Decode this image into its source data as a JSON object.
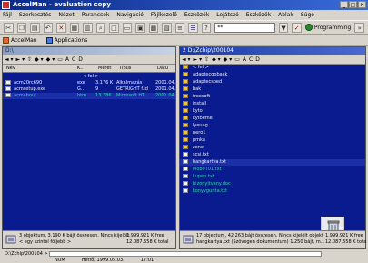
{
  "window": {
    "title": "AccelMan - evaluation copy"
  },
  "menu": [
    "Fájl",
    "Szerkesztés",
    "Nézet",
    "Parancsok",
    "Navigáció",
    "Fájlkezelő",
    "Eszközök",
    "Lejátszó",
    "Eszközök",
    "Ablak",
    "Súgó"
  ],
  "toolbar": {
    "combo_value": "**",
    "program_label": "Programming"
  },
  "toolbar2": {
    "accelman_label": "AccelMan",
    "applications_label": "Applications"
  },
  "left_panel": {
    "path": "D:\\",
    "columns": {
      "name": "Név",
      "ext": "K..",
      "size": "Méret",
      "type": "Típus",
      "date": "Dátu"
    },
    "files": [
      {
        "name": "acm20rc690",
        "ext": "exe",
        "size": "3.176 K",
        "type": "Alkalmazás",
        "date": "2001.04."
      },
      {
        "name": "acmsetup.exe",
        "ext": "G..",
        "size": "9",
        "type": "GETRIGHT f.id",
        "date": "2001.04."
      },
      {
        "name": "acmabout",
        "ext": "htm",
        "size": "13.786",
        "type": "Microsoft HT...",
        "date": "2001.04."
      }
    ],
    "status_line1": "3 objektum, 3.190 K bájt összesen. Nincs kijelölt",
    "status_line2": "< egy szintel följebb >",
    "status_free1": "1.999.921 K free",
    "status_free2": "12.087.558 K total"
  },
  "right_panel": {
    "path": "2 D:\\Zchip\\200104",
    "up_label": "< fel >",
    "folders": [
      "adaptecgoback",
      "adaptecsoed",
      "bak",
      "freesoft",
      "install",
      "kyto",
      "kytoeme",
      "lyeuag",
      "nero1",
      "pmka",
      "zene"
    ],
    "files": [
      "scsi.txt",
      "hangkartya.txt",
      "Mob0T01.txt",
      "Lupen.txt",
      "bizonyitvany.doc",
      "konyvgurita.txt"
    ],
    "status_line1": "17 objektum, 42.263 bájt összesen. Nincs kijelölt objekt",
    "status_line2": "hangkartya.txt (Szövegen dokumentum) 1.250 bájt, m...",
    "status_free1": "1.999.921 K free",
    "status_free2": "12.087.558 K tota"
  },
  "command": {
    "label": "D:\\Zchip\\200104 >"
  },
  "statusbar": {
    "num": "NUM",
    "date": "Hetfő, 1999.05.03.",
    "time": "17:01"
  }
}
